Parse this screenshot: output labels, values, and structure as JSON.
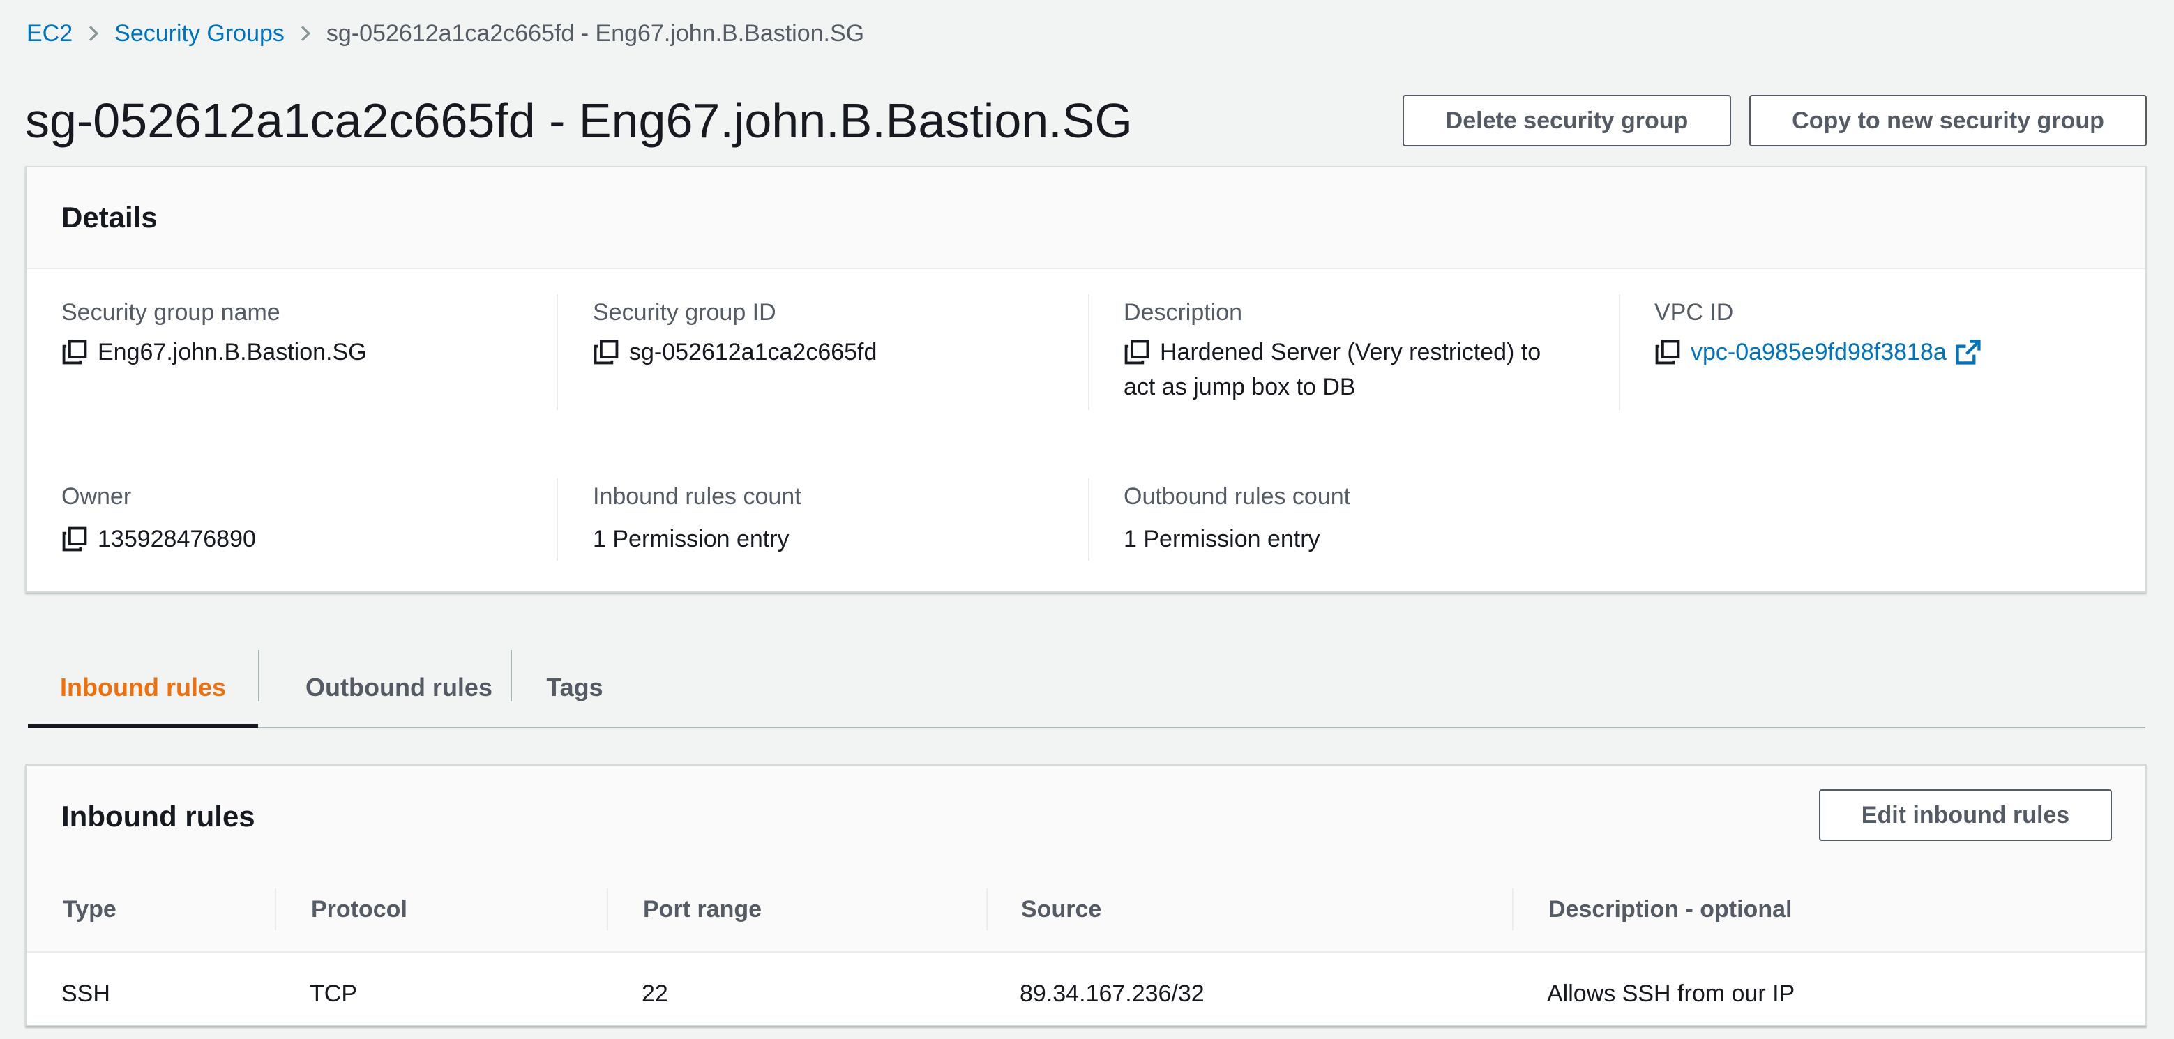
{
  "breadcrumb": {
    "items": [
      "EC2",
      "Security Groups",
      "sg-052612a1ca2c665fd - Eng67.john.B.Bastion.SG"
    ]
  },
  "page": {
    "title": "sg-052612a1ca2c665fd - Eng67.john.B.Bastion.SG"
  },
  "actions": {
    "delete_label": "Delete security group",
    "copy_label": "Copy to new security group"
  },
  "details": {
    "header": "Details",
    "security_group_name": {
      "label": "Security group name",
      "value": "Eng67.john.B.Bastion.SG"
    },
    "security_group_id": {
      "label": "Security group ID",
      "value": "sg-052612a1ca2c665fd"
    },
    "description": {
      "label": "Description",
      "value": "Hardened Server (Very restricted) to act as jump box to DB"
    },
    "vpc_id": {
      "label": "VPC ID",
      "value": "vpc-0a985e9fd98f3818a"
    },
    "owner": {
      "label": "Owner",
      "value": "135928476890"
    },
    "inbound_count": {
      "label": "Inbound rules count",
      "value": "1 Permission entry"
    },
    "outbound_count": {
      "label": "Outbound rules count",
      "value": "1 Permission entry"
    }
  },
  "tabs": [
    {
      "label": "Inbound rules",
      "active": true
    },
    {
      "label": "Outbound rules",
      "active": false
    },
    {
      "label": "Tags",
      "active": false
    }
  ],
  "inbound": {
    "header": "Inbound rules",
    "edit_label": "Edit inbound rules",
    "columns": [
      "Type",
      "Protocol",
      "Port range",
      "Source",
      "Description - optional"
    ],
    "rows": [
      [
        "SSH",
        "TCP",
        "22",
        "89.34.167.236/32",
        "Allows SSH from our IP"
      ]
    ]
  },
  "colors": {
    "link": "#0073bb",
    "active_tab": "#ec7211",
    "background": "#f2f3f3",
    "text": "#16191f",
    "muted": "#545b64"
  },
  "icons": [
    "chevron-right-icon",
    "copy-icon",
    "external-link-icon"
  ]
}
